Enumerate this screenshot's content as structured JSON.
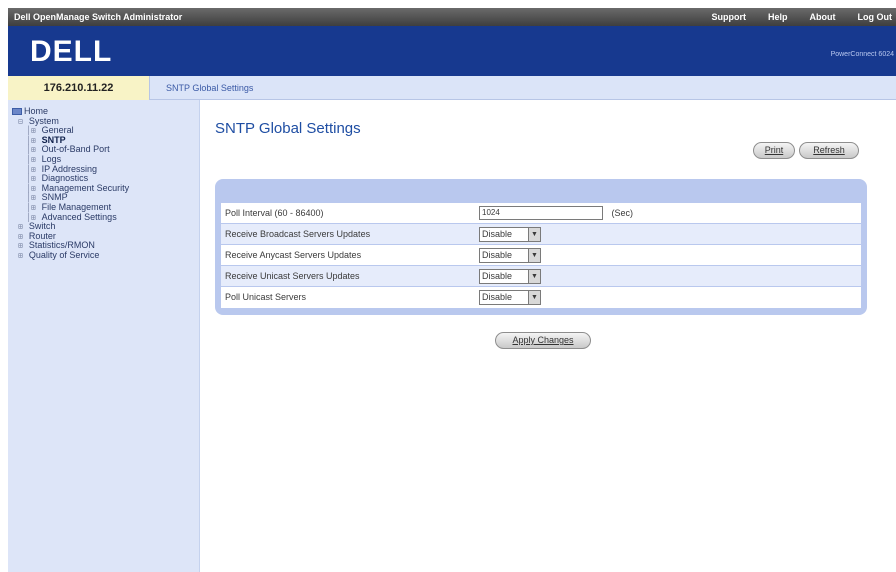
{
  "topbar": {
    "app_title": "Dell OpenManage Switch Administrator",
    "links": [
      "Support",
      "Help",
      "About",
      "Log Out"
    ]
  },
  "banner": {
    "logo_text": "DELL",
    "product": "PowerConnect 6024"
  },
  "crumbbar": {
    "ip": "176.210.11.22",
    "breadcrumb": "SNTP Global Settings"
  },
  "tree": [
    {
      "glyph": "",
      "label": "Home",
      "icon": "folder-icon",
      "selected": false
    },
    {
      "glyph": "⊟",
      "label": "System",
      "selected": false
    },
    {
      "glyph": "│⊞",
      "label": "General",
      "selected": false
    },
    {
      "glyph": "│⊞",
      "label": "SNTP",
      "selected": true
    },
    {
      "glyph": "│⊞",
      "label": "Out-of-Band Port",
      "selected": false
    },
    {
      "glyph": "│⊞",
      "label": "Logs",
      "selected": false
    },
    {
      "glyph": "│⊞",
      "label": "IP Addressing",
      "selected": false
    },
    {
      "glyph": "│⊞",
      "label": "Diagnostics",
      "selected": false
    },
    {
      "glyph": "│⊞",
      "label": "Management Security",
      "selected": false
    },
    {
      "glyph": "│⊞",
      "label": "SNMP",
      "selected": false
    },
    {
      "glyph": "│⊞",
      "label": "File Management",
      "selected": false
    },
    {
      "glyph": "│⊞",
      "label": "Advanced Settings",
      "selected": false
    },
    {
      "glyph": "⊞",
      "label": "Switch",
      "selected": false
    },
    {
      "glyph": "⊞",
      "label": "Router",
      "selected": false
    },
    {
      "glyph": "⊞",
      "label": "Statistics/RMON",
      "selected": false
    },
    {
      "glyph": "⊞",
      "label": "Quality of Service",
      "selected": false
    }
  ],
  "main": {
    "title": "SNTP Global Settings",
    "print_label": "Print",
    "refresh_label": "Refresh",
    "apply_label": "Apply Changes",
    "fields": [
      {
        "label": "Poll Interval (60 - 86400)",
        "type": "text",
        "value": "1024",
        "unit": "(Sec)"
      },
      {
        "label": "Receive Broadcast Servers Updates",
        "type": "select",
        "value": "Disable"
      },
      {
        "label": "Receive Anycast Servers Updates",
        "type": "select",
        "value": "Disable"
      },
      {
        "label": "Receive Unicast Servers Updates",
        "type": "select",
        "value": "Disable"
      },
      {
        "label": "Poll Unicast Servers",
        "type": "select",
        "value": "Disable"
      }
    ]
  }
}
